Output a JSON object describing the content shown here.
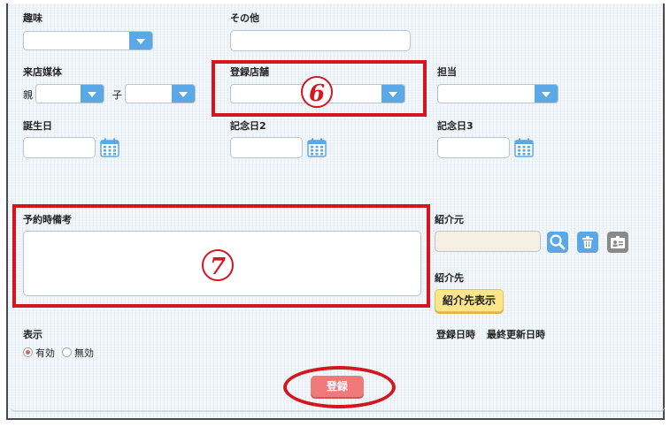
{
  "labels": {
    "hobby": "趣味",
    "other": "その他",
    "visit_media": "来店媒体",
    "parent": "親",
    "child": "子",
    "store": "登録店舗",
    "staff": "担当",
    "birthday": "誕生日",
    "anniversary2": "記念日2",
    "anniversary3": "記念日3",
    "reservation_note": "予約時備考",
    "referrer": "紹介元",
    "referred": "紹介先",
    "display": "表示",
    "reg_date": "登録日時",
    "last_update": "最終更新日時"
  },
  "buttons": {
    "show_referred": "紹介先表示",
    "register": "登録"
  },
  "radio": {
    "enabled": "有効",
    "disabled": "無効"
  },
  "markers": {
    "six": "6",
    "seven": "7"
  },
  "colors": {
    "accent_blue": "#5aa9e6",
    "annotation_red": "#d5161e",
    "register_button": "#f07a7a",
    "yellow_button": "#fde68a"
  }
}
